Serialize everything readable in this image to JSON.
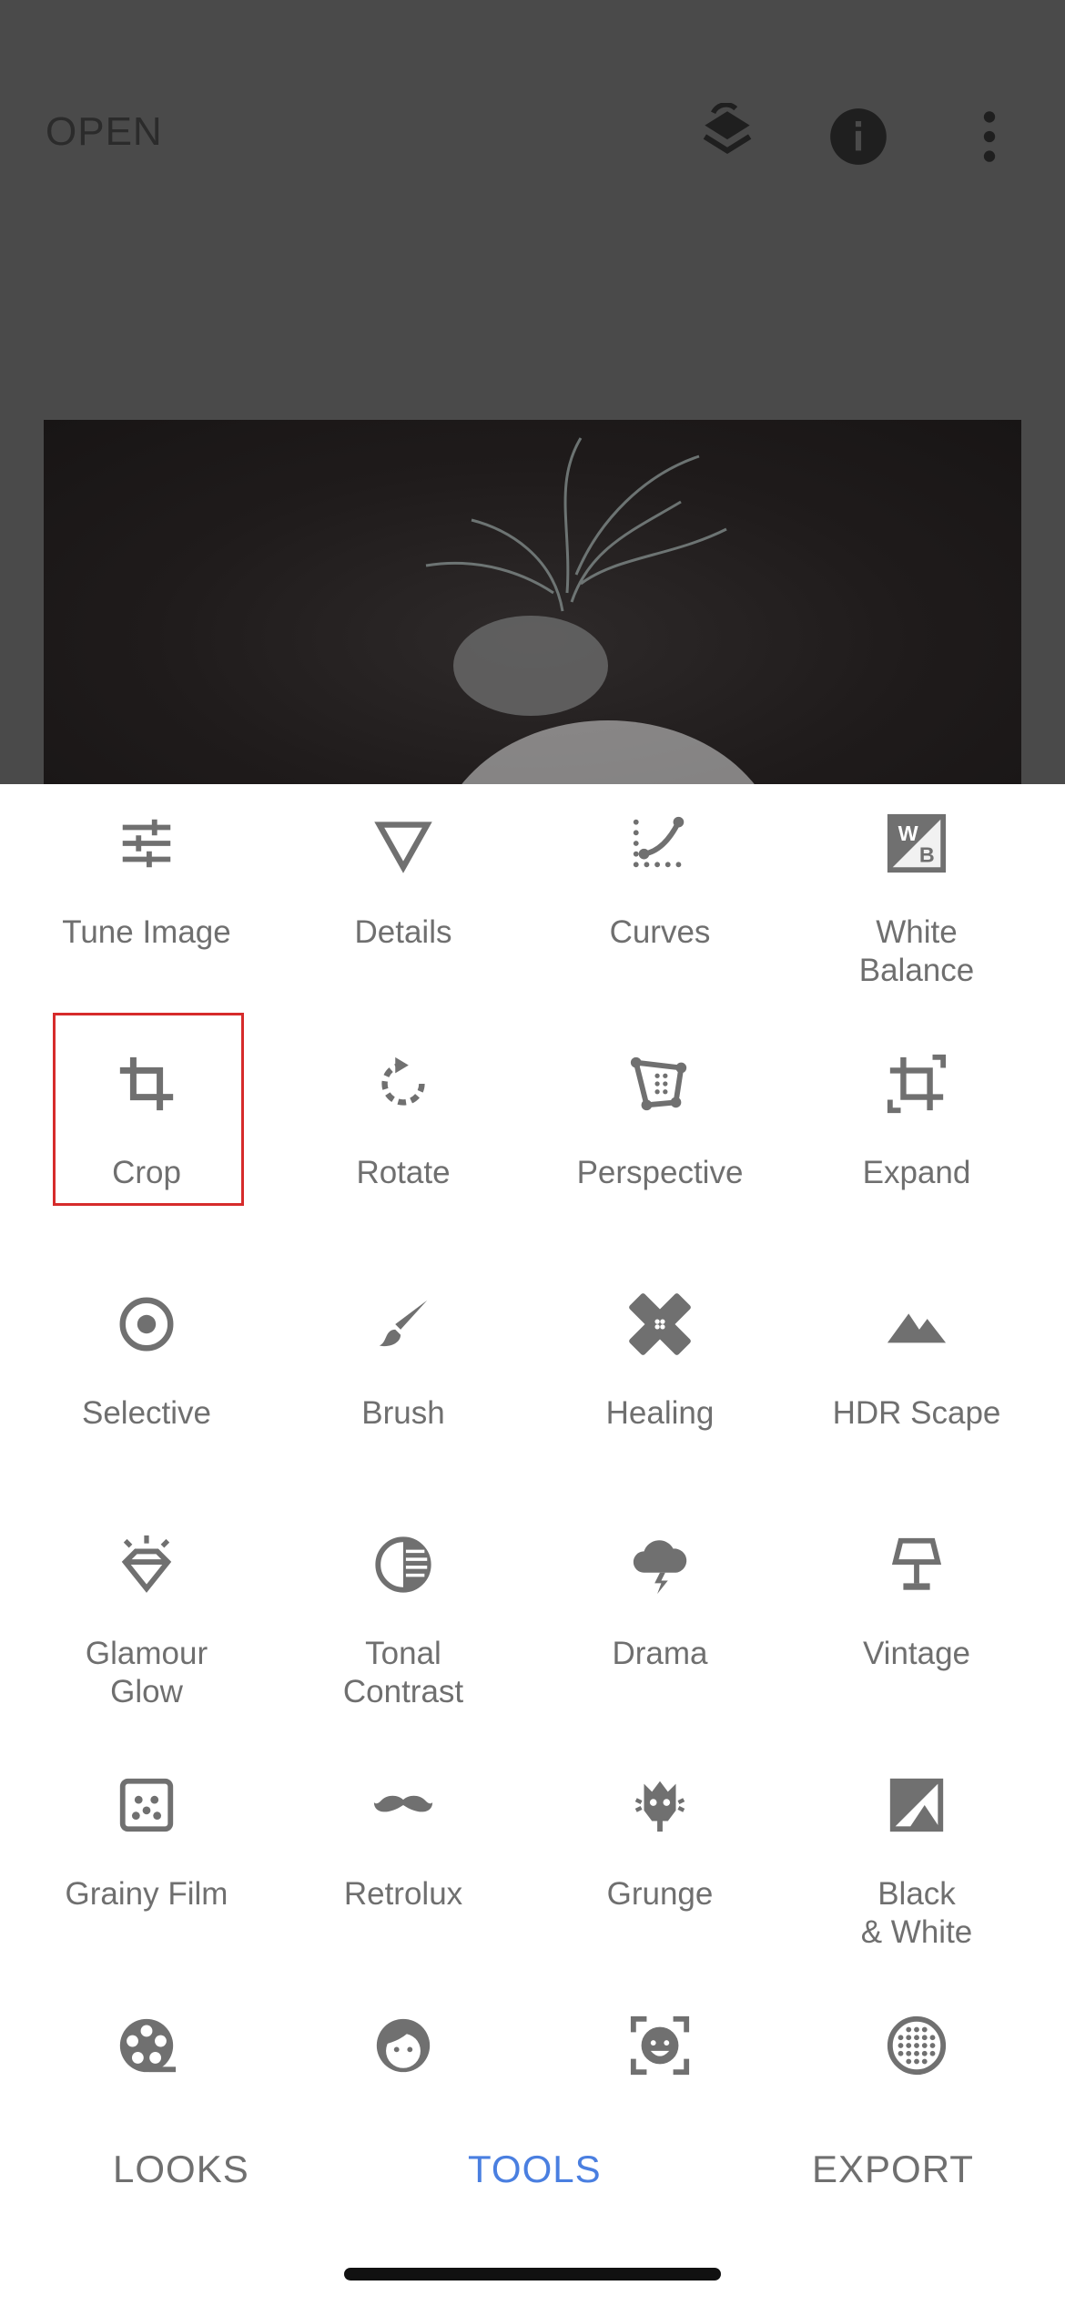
{
  "header": {
    "open_label": "OPEN",
    "icons": [
      "layers-undo-icon",
      "info-icon",
      "more-vert-icon"
    ]
  },
  "tools": [
    {
      "label": "Tune Image",
      "icon": "sliders-icon"
    },
    {
      "label": "Details",
      "icon": "triangle-down-icon"
    },
    {
      "label": "Curves",
      "icon": "curves-icon"
    },
    {
      "label": "White\nBalance",
      "icon": "white-balance-icon"
    },
    {
      "label": "Crop",
      "icon": "crop-icon"
    },
    {
      "label": "Rotate",
      "icon": "rotate-icon"
    },
    {
      "label": "Perspective",
      "icon": "perspective-icon"
    },
    {
      "label": "Expand",
      "icon": "expand-icon"
    },
    {
      "label": "Selective",
      "icon": "selective-icon"
    },
    {
      "label": "Brush",
      "icon": "brush-icon"
    },
    {
      "label": "Healing",
      "icon": "healing-icon"
    },
    {
      "label": "HDR Scape",
      "icon": "mountain-icon"
    },
    {
      "label": "Glamour\nGlow",
      "icon": "diamond-icon"
    },
    {
      "label": "Tonal\nContrast",
      "icon": "tonal-contrast-icon"
    },
    {
      "label": "Drama",
      "icon": "storm-cloud-icon"
    },
    {
      "label": "Vintage",
      "icon": "lamp-icon"
    },
    {
      "label": "Grainy Film",
      "icon": "grain-icon"
    },
    {
      "label": "Retrolux",
      "icon": "mustache-icon"
    },
    {
      "label": "Grunge",
      "icon": "grunge-icon"
    },
    {
      "label": "Black\n& White",
      "icon": "black-white-icon"
    },
    {
      "label": "",
      "icon": "film-reel-icon"
    },
    {
      "label": "",
      "icon": "face-icon"
    },
    {
      "label": "",
      "icon": "face-pose-icon"
    },
    {
      "label": "",
      "icon": "dots-circle-icon"
    }
  ],
  "tabs": {
    "looks": "LOOKS",
    "tools": "TOOLS",
    "export": "EXPORT",
    "active": "TOOLS"
  },
  "colors": {
    "accent": "#4a7fe0",
    "highlight": "#d62b2b",
    "icon": "#6f6f6f"
  }
}
